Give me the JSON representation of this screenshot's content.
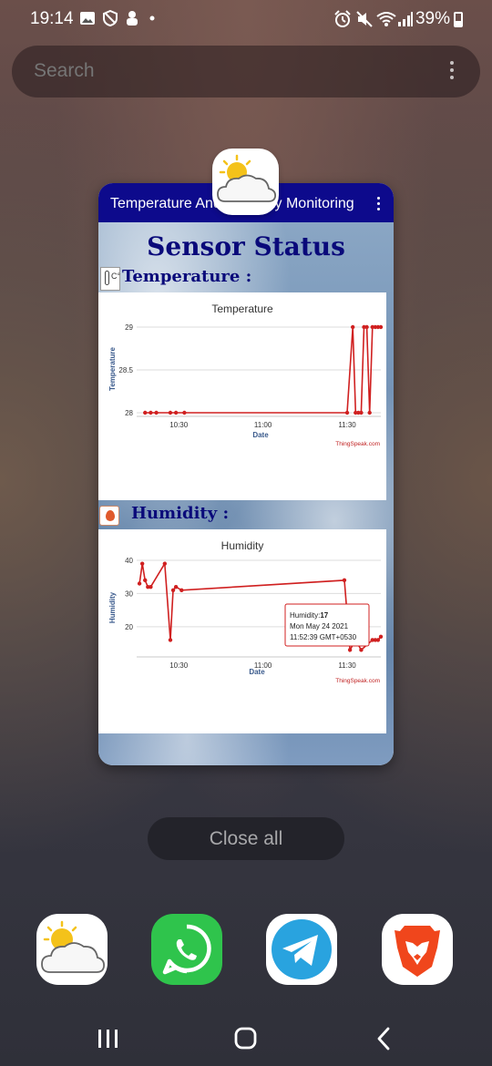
{
  "status_bar": {
    "time": "19:14",
    "battery": "39%",
    "icons": [
      "gallery-icon",
      "shield-icon",
      "puppy-icon",
      "dot-icon",
      "alarm-icon",
      "mute-icon",
      "wifi-icon",
      "signal-icon",
      "battery-icon"
    ]
  },
  "search": {
    "placeholder": "Search"
  },
  "recent_app": {
    "title": "Temperature And Humidity Monitoring",
    "heading": "Sensor Status",
    "temperature_label": "Temperature :",
    "humidity_label": "Humidity :",
    "thermo_unit": "C°"
  },
  "chart_data": [
    {
      "type": "line",
      "title": "Temperature",
      "xlabel": "Date",
      "ylabel": "Temperature",
      "x_ticks": [
        "10:30",
        "11:00",
        "11:30"
      ],
      "y_ticks": [
        "28",
        "28.5",
        "29"
      ],
      "ylim": [
        28,
        29
      ],
      "xlim": [
        "10:15",
        "11:42"
      ],
      "grid": true,
      "credit": "ThingSpeak.com",
      "series": [
        {
          "color": "#d02020",
          "points": [
            [
              "10:18",
              28
            ],
            [
              "10:20",
              28
            ],
            [
              "10:22",
              28
            ],
            [
              "10:27",
              28
            ],
            [
              "10:29",
              28
            ],
            [
              "10:32",
              28
            ],
            [
              "11:30",
              28
            ],
            [
              "11:32",
              29
            ],
            [
              "11:33",
              28
            ],
            [
              "11:34",
              28
            ],
            [
              "11:35",
              28
            ],
            [
              "11:36",
              29
            ],
            [
              "11:37",
              29
            ],
            [
              "11:38",
              28
            ],
            [
              "11:39",
              29
            ],
            [
              "11:40",
              29
            ],
            [
              "11:41",
              29
            ],
            [
              "11:42",
              29
            ]
          ]
        }
      ]
    },
    {
      "type": "line",
      "title": "Humidity",
      "xlabel": "Date",
      "ylabel": "Humidity",
      "x_ticks": [
        "10:30",
        "11:00",
        "11:30"
      ],
      "y_ticks": [
        "20",
        "30",
        "40"
      ],
      "ylim": [
        12,
        40
      ],
      "xlim": [
        "10:15",
        "11:42"
      ],
      "grid": true,
      "credit": "ThingSpeak.com",
      "tooltip": {
        "label": "Humidity:",
        "value": "17",
        "date": "Mon May 24 2021",
        "time": "11:52:39 GMT+0530"
      },
      "series": [
        {
          "color": "#d02020",
          "points": [
            [
              "10:16",
              33
            ],
            [
              "10:17",
              39
            ],
            [
              "10:18",
              34
            ],
            [
              "10:19",
              32
            ],
            [
              "10:20",
              32
            ],
            [
              "10:25",
              39
            ],
            [
              "10:27",
              16
            ],
            [
              "10:28",
              31
            ],
            [
              "10:29",
              32
            ],
            [
              "10:31",
              31
            ],
            [
              "11:29",
              34
            ],
            [
              "11:31",
              13
            ],
            [
              "11:33",
              16
            ],
            [
              "11:35",
              13
            ],
            [
              "11:39",
              16
            ],
            [
              "11:40",
              16
            ],
            [
              "11:41",
              16
            ],
            [
              "11:42",
              17
            ]
          ]
        }
      ]
    }
  ],
  "close_all": "Close all",
  "dock": [
    {
      "name": "weather-app-icon"
    },
    {
      "name": "whatsapp-app-icon"
    },
    {
      "name": "telegram-app-icon"
    },
    {
      "name": "brave-app-icon"
    }
  ],
  "nav": [
    "recents-button",
    "home-button",
    "back-button"
  ]
}
